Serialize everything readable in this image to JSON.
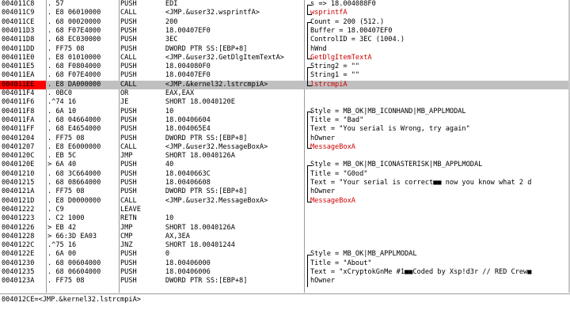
{
  "rows": [
    {
      "addr": "004011C8",
      "bytes": ". 57",
      "disasm": "PUSH       EDI",
      "comment": "s => 18.004088F0",
      "cred": false
    },
    {
      "addr": "004011C9",
      "bytes": ". E8 06010000",
      "disasm": "CALL       <JMP.&user32.wsprintfA>",
      "comment": "wsprintfA",
      "cred": true
    },
    {
      "addr": "004011CE",
      "bytes": ". 68 00020000",
      "disasm": "PUSH       200",
      "comment": "Count = 200 (512.)",
      "cred": false
    },
    {
      "addr": "004011D3",
      "bytes": ". 68 F07E4000",
      "disasm": "PUSH       18.00407EF0",
      "comment": "Buffer = 18.00407EF0",
      "cred": false
    },
    {
      "addr": "004011D8",
      "bytes": ". 68 EC030000",
      "disasm": "PUSH       3EC",
      "comment": "ControlID = 3EC (1004.)",
      "cred": false
    },
    {
      "addr": "004011DD",
      "bytes": ". FF75 08",
      "disasm": "PUSH       DWORD PTR SS:[EBP+8]",
      "comment": "hWnd",
      "cred": false
    },
    {
      "addr": "004011E0",
      "bytes": ". E8 01010000",
      "disasm": "CALL       <JMP.&user32.GetDlgItemTextA>",
      "comment": "GetDlgItemTextA",
      "cred": true
    },
    {
      "addr": "004011E5",
      "bytes": ". 68 F0804000",
      "disasm": "PUSH       18.004080F0",
      "comment": "String2 = \"\"",
      "cred": false
    },
    {
      "addr": "004011EA",
      "bytes": ". 68 F07E4000",
      "disasm": "PUSH       18.00407EF0",
      "comment": "String1 = \"\"",
      "cred": false
    },
    {
      "addr": "004011EE",
      "bytes": ". E8 DA000000",
      "disasm": "CALL       <JMP.&kernel32.lstrcmpiA>",
      "comment": "lstrcmpiA",
      "cred": true
    },
    {
      "addr": "004011F4",
      "bytes": ". 0BC0",
      "disasm": "OR         EAX,EAX",
      "comment": "",
      "cred": false
    },
    {
      "addr": "004011F6",
      "bytes": ".^74 16",
      "disasm": "JE         SHORT 18.0040120E",
      "comment": "",
      "cred": false
    },
    {
      "addr": "004011F8",
      "bytes": ". 6A 10",
      "disasm": "PUSH       10",
      "comment": "Style = MB_OK|MB_ICONHAND|MB_APPLMODAL",
      "cred": false
    },
    {
      "addr": "004011FA",
      "bytes": ". 68 04664000",
      "disasm": "PUSH       18.00406604",
      "comment": "Title = \"Bad\"",
      "cred": false
    },
    {
      "addr": "004011FF",
      "bytes": ". 68 E4654000",
      "disasm": "PUSH       18.004065E4",
      "comment": "Text = \"You serial is Wrong, try again\"",
      "cred": false
    },
    {
      "addr": "00401204",
      "bytes": ". FF75 08",
      "disasm": "PUSH       DWORD PTR SS:[EBP+8]",
      "comment": "hOwner",
      "cred": false
    },
    {
      "addr": "00401207",
      "bytes": ". E8 E6000000",
      "disasm": "CALL       <JMP.&user32.MessageBoxA>",
      "comment": "MessageBoxA",
      "cred": true
    },
    {
      "addr": "0040120C",
      "bytes": ". EB 5C",
      "disasm": "JMP        SHORT 18.0040126A",
      "comment": "",
      "cred": false
    },
    {
      "addr": "0040120E",
      "bytes": "> 6A 40",
      "disasm": "PUSH       40",
      "comment": "Style = MB_OK|MB_ICONASTERISK|MB_APPLMODAL",
      "cred": false
    },
    {
      "addr": "00401210",
      "bytes": ". 68 3C664000",
      "disasm": "PUSH       18.0040663C",
      "comment": "Title = \"G0od\"",
      "cred": false
    },
    {
      "addr": "00401215",
      "bytes": ". 68 08664000",
      "disasm": "PUSH       18.00406608",
      "comment": "Text = \"Your serial is correct■■ now you know what 2 d",
      "cred": false
    },
    {
      "addr": "0040121A",
      "bytes": ". FF75 08",
      "disasm": "PUSH       DWORD PTR SS:[EBP+8]",
      "comment": "hOwner",
      "cred": false
    },
    {
      "addr": "0040121D",
      "bytes": ". E8 D0000000",
      "disasm": "CALL       <JMP.&user32.MessageBoxA>",
      "comment": "MessageBoxA",
      "cred": true
    },
    {
      "addr": "00401222",
      "bytes": ". C9",
      "disasm": "LEAVE",
      "comment": "",
      "cred": false
    },
    {
      "addr": "00401223",
      "bytes": ". C2 1000",
      "disasm": "RETN       10",
      "comment": "",
      "cred": false
    },
    {
      "addr": "00401226",
      "bytes": "> EB 42",
      "disasm": "JMP        SHORT 18.0040126A",
      "comment": "",
      "cred": false
    },
    {
      "addr": "00401228",
      "bytes": "> 66:3D EA03",
      "disasm": "CMP        AX,3EA",
      "comment": "",
      "cred": false
    },
    {
      "addr": "0040122C",
      "bytes": ".^75 16",
      "disasm": "JNZ        SHORT 18.00401244",
      "comment": "",
      "cred": false
    },
    {
      "addr": "0040122E",
      "bytes": ". 6A 00",
      "disasm": "PUSH       0",
      "comment": "Style = MB_OK|MB_APPLMODAL",
      "cred": false
    },
    {
      "addr": "00401230",
      "bytes": ". 68 00604000",
      "disasm": "PUSH       18.00406000",
      "comment": "Title = \"About\"",
      "cred": false
    },
    {
      "addr": "00401235",
      "bytes": ". 68 06604000",
      "disasm": "PUSH       18.00406006",
      "comment": "Text = \"xCryptokGnMe #1■■Coded by Xsp!d3r // RED Crew■",
      "cred": false
    },
    {
      "addr": "0040123A",
      "bytes": ". FF75 08",
      "disasm": "PUSH       DWORD PTR SS:[EBP+8]",
      "comment": "hOwner",
      "cred": false
    }
  ],
  "selected_row": 9,
  "status": {
    "text": "004012CE=<JMP.&kernel32.lstrcmpiA>"
  },
  "colors": {
    "selected_row_bg": "#c0c0c0",
    "address_highlight": "#ff0000",
    "api_comment": "#cc0000"
  }
}
